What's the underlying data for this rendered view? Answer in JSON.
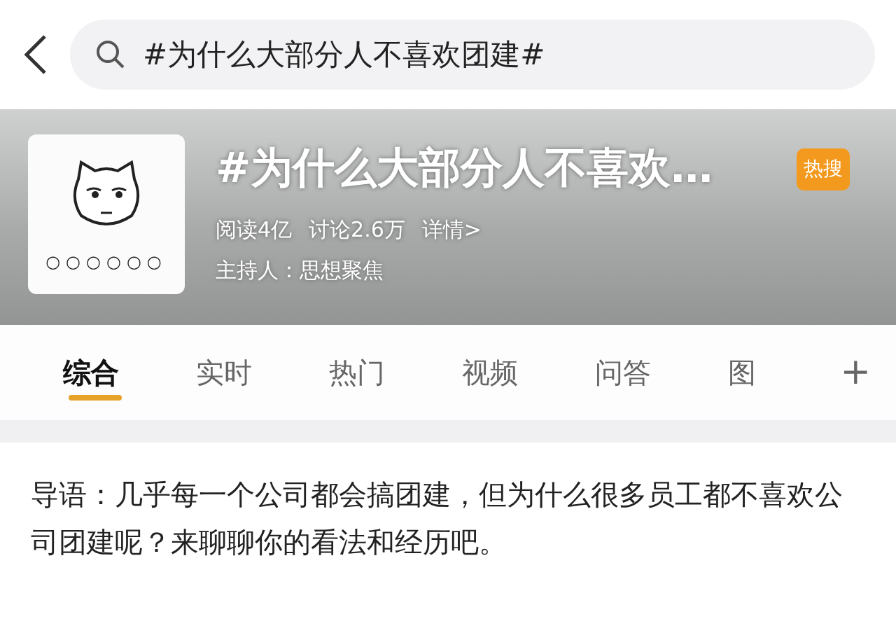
{
  "search": {
    "value": "#为什么大部分人不喜欢团建#"
  },
  "topic": {
    "title": "#为什么大部分人不喜欢…",
    "badge": "热搜",
    "stats": [
      "阅读4亿",
      "讨论2.6万",
      "详情>"
    ],
    "host": "主持人：思想聚焦",
    "avatar_dots": "○○○○○○"
  },
  "tabs": [
    {
      "label": "综合",
      "selected": true
    },
    {
      "label": "实时",
      "selected": false
    },
    {
      "label": "热门",
      "selected": false
    },
    {
      "label": "视频",
      "selected": false
    },
    {
      "label": "问答",
      "selected": false
    },
    {
      "label": "图",
      "selected": false
    }
  ],
  "add_tab": "+",
  "intro": "导语：几乎每一个公司都会搞团建，但为什么很多员工都不喜欢公司团建呢？来聊聊你的看法和经历吧。"
}
